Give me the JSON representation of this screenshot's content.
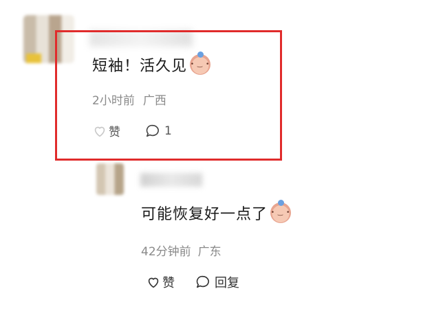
{
  "comments": [
    {
      "text": "短袖！活久见",
      "emoji_icon": "blushing-baby-emoji-icon",
      "time": "2小时前",
      "location": "广西",
      "like_label": "赞",
      "reply_count": "1"
    },
    {
      "text": "可能恢复好一点了",
      "emoji_icon": "blushing-baby-emoji-icon",
      "time": "42分钟前",
      "location": "广东",
      "like_label": "赞",
      "reply_label": "回复"
    }
  ],
  "colors": {
    "highlight": "#e02b2b",
    "meta_text": "#8a8a8a"
  }
}
